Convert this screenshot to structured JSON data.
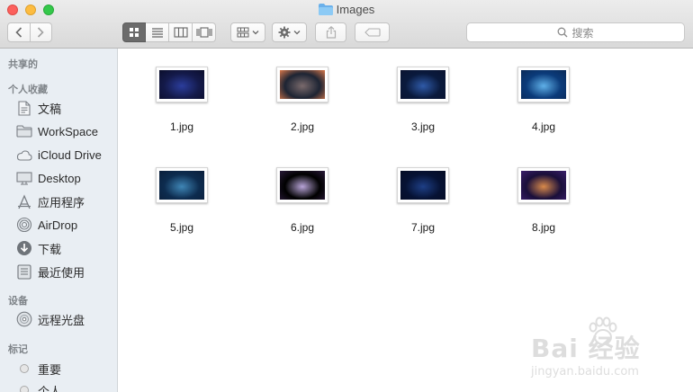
{
  "window": {
    "title": "Images"
  },
  "search": {
    "placeholder": "搜索"
  },
  "sidebar": {
    "sections": [
      {
        "label": "共享的"
      },
      {
        "label": "个人收藏"
      },
      {
        "label": "设备"
      },
      {
        "label": "标记"
      }
    ],
    "favorites": [
      {
        "label": "文稿",
        "icon": "document-icon"
      },
      {
        "label": "WorkSpace",
        "icon": "folder-icon"
      },
      {
        "label": "iCloud Drive",
        "icon": "cloud-icon"
      },
      {
        "label": "Desktop",
        "icon": "desktop-icon"
      },
      {
        "label": "应用程序",
        "icon": "applications-icon"
      },
      {
        "label": "AirDrop",
        "icon": "airdrop-icon"
      },
      {
        "label": "下载",
        "icon": "download-icon"
      },
      {
        "label": "最近使用",
        "icon": "recents-icon"
      }
    ],
    "devices": [
      {
        "label": "远程光盘",
        "icon": "disc-icon"
      }
    ],
    "tags": [
      {
        "label": "重要",
        "color": "#e6e6e6"
      },
      {
        "label": "个人",
        "color": "#e6e6e6"
      }
    ]
  },
  "files": [
    {
      "name": "1.jpg",
      "colors": [
        "#141a4a",
        "#2b3d9c",
        "#0b0e2b"
      ]
    },
    {
      "name": "2.jpg",
      "colors": [
        "#1d2433",
        "#7a6a6c",
        "#d9784a"
      ]
    },
    {
      "name": "3.jpg",
      "colors": [
        "#0a1a3d",
        "#2f5aa8",
        "#0b1330"
      ]
    },
    {
      "name": "4.jpg",
      "colors": [
        "#0b3b7a",
        "#5fb0e8",
        "#0a2a58"
      ]
    },
    {
      "name": "5.jpg",
      "colors": [
        "#0d2c4f",
        "#3f86b6",
        "#0a1e3a"
      ]
    },
    {
      "name": "6.jpg",
      "colors": [
        "#000000",
        "#b8a4d8",
        "#2a1a3a"
      ]
    },
    {
      "name": "7.jpg",
      "colors": [
        "#061234",
        "#1e3f86",
        "#050c24"
      ]
    },
    {
      "name": "8.jpg",
      "colors": [
        "#1a0f3a",
        "#d98a4a",
        "#3a1e6a"
      ]
    }
  ],
  "watermark": {
    "text": "Bai 经验",
    "sub": "jingyan.baidu.com"
  }
}
